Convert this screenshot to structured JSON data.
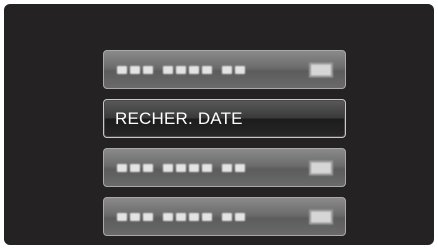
{
  "menu": {
    "items": [
      {
        "label": "",
        "state": "dimmed"
      },
      {
        "label": "RECHER. DATE",
        "state": "selected"
      },
      {
        "label": "",
        "state": "dimmed"
      },
      {
        "label": "",
        "state": "dimmed"
      }
    ]
  },
  "colors": {
    "screen_background": "#252223",
    "item_dimmed": "#6c6c6c",
    "item_selected": "#262626",
    "text": "#ffffff"
  }
}
